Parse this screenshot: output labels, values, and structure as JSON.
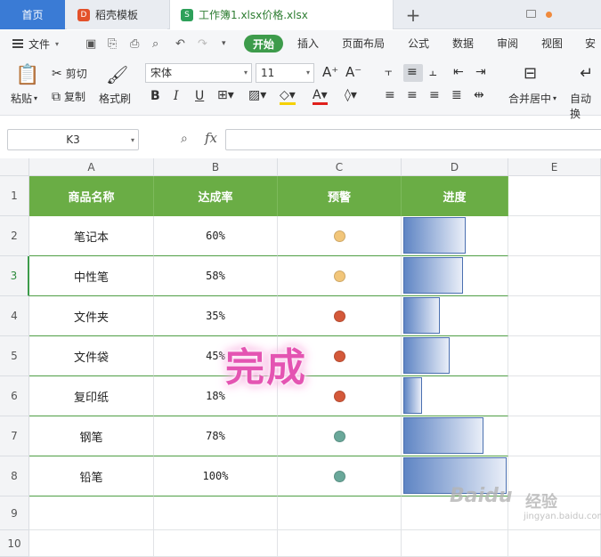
{
  "tabs": {
    "home": "首页",
    "template": "稻壳模板",
    "file": "工作簿1.xlsx价格.xlsx",
    "add": "+"
  },
  "menu": {
    "file": "文件",
    "items": [
      "开始",
      "插入",
      "页面布局",
      "公式",
      "数据",
      "审阅",
      "视图",
      "安全"
    ]
  },
  "ribbon": {
    "paste": "粘贴",
    "cut": "剪切",
    "copy": "复制",
    "format_painter": "格式刷",
    "font": "宋体",
    "size": "11",
    "merge": "合并居中",
    "autowrap": "自动换"
  },
  "formula_bar": {
    "cell_ref": "K3",
    "fx": "fx",
    "value": ""
  },
  "columns": [
    "A",
    "B",
    "C",
    "D",
    "E"
  ],
  "rows": [
    "1",
    "2",
    "3",
    "4",
    "5",
    "6",
    "7",
    "8",
    "9",
    "10"
  ],
  "table": {
    "headers": [
      "商品名称",
      "达成率",
      "预警",
      "进度"
    ],
    "rows": [
      {
        "name": "笔记本",
        "rate": "60%",
        "progress": 0.6,
        "alert": "yellow"
      },
      {
        "name": "中性笔",
        "rate": "58%",
        "progress": 0.58,
        "alert": "yellow"
      },
      {
        "name": "文件夹",
        "rate": "35%",
        "progress": 0.35,
        "alert": "red"
      },
      {
        "name": "文件袋",
        "rate": "45%",
        "progress": 0.45,
        "alert": "red"
      },
      {
        "name": "复印纸",
        "rate": "18%",
        "progress": 0.18,
        "alert": "red"
      },
      {
        "name": "钢笔",
        "rate": "78%",
        "progress": 0.78,
        "alert": "green"
      },
      {
        "name": "铅笔",
        "rate": "100%",
        "progress": 1.0,
        "alert": "green"
      }
    ]
  },
  "alert_colors": {
    "yellow": "#f2c67a",
    "red": "#d4593a",
    "green": "#6aa89a"
  },
  "overlay_text": "完成",
  "watermark": {
    "brand": "Baidu",
    "text": "经验",
    "url": "jingyan.baidu.com"
  }
}
